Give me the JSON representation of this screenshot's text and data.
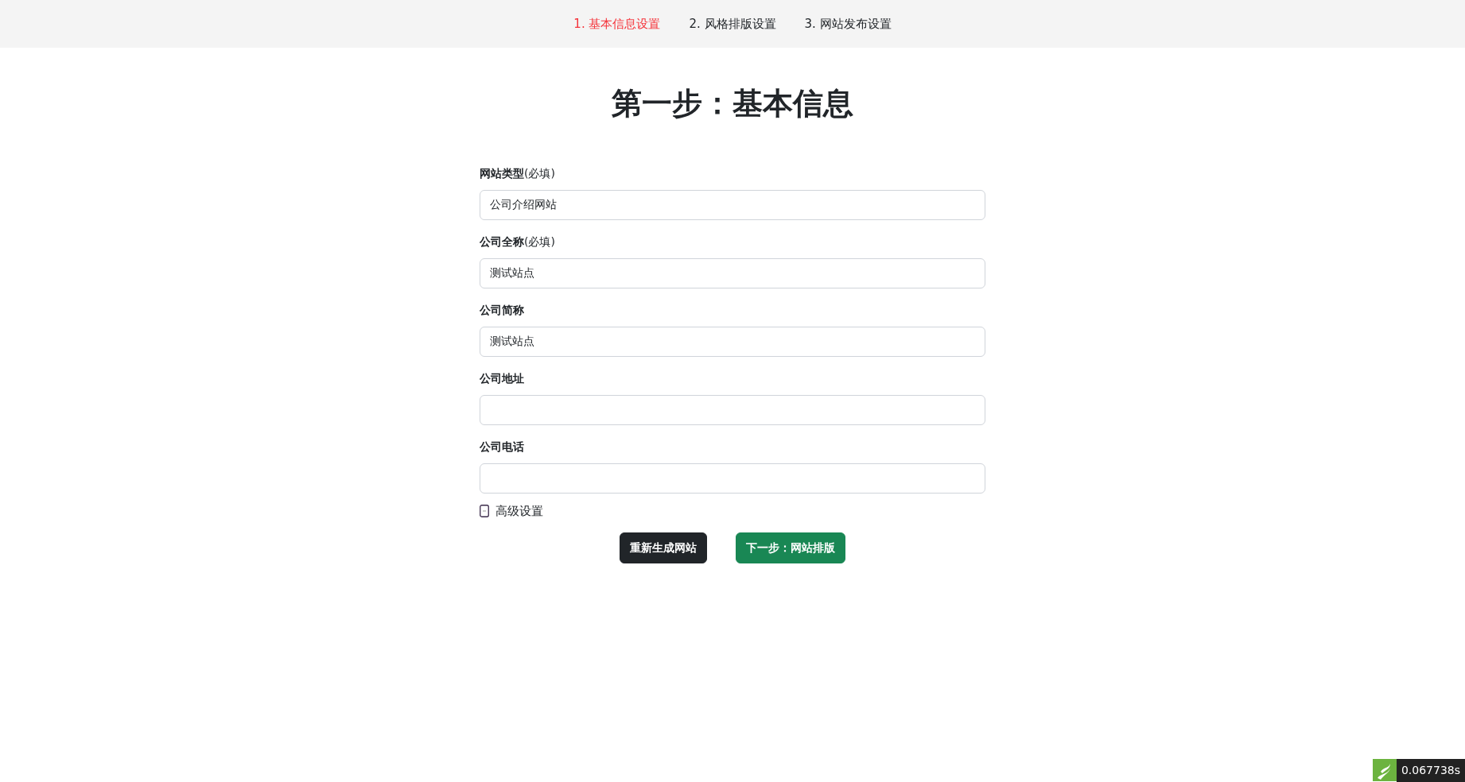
{
  "steps": [
    {
      "label": "1. 基本信息设置",
      "selected": true
    },
    {
      "label": "2. 风格排版设置",
      "selected": false
    },
    {
      "label": "3. 网站发布设置",
      "selected": false
    }
  ],
  "heading": "第一步：基本信息",
  "fields": [
    {
      "label": "**网站类型**(必填)",
      "value": "公司介绍网站"
    },
    {
      "label": "**公司全称**(必填)",
      "value": "测试站点"
    },
    {
      "label": "**公司简称**",
      "value": "测试站点"
    },
    {
      "label": "**公司地址**"
    },
    {
      "label": "**公司电话**"
    }
  ],
  "advanced_toggle": {
    "label": "高级设置",
    "expanded": true
  },
  "buttons": [
    {
      "label": "重新生成网站",
      "kind": "dark"
    },
    {
      "label": "下一步：网站排版",
      "kind": "success"
    }
  ],
  "timer_badge": {
    "text": "0.067738s"
  }
}
